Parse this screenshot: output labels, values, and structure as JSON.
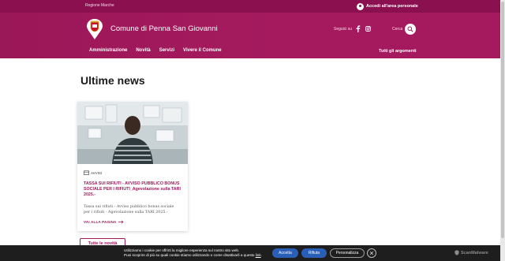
{
  "topbar": {
    "region": "Regione Marche",
    "login": "Accedi all'area personale",
    "login_icon": "user-icon"
  },
  "header": {
    "title": "Comune di Penna San Giovanni",
    "follow_label": "Seguici su",
    "social": [
      "facebook-icon",
      "instagram-icon"
    ],
    "search_label": "Cerca",
    "search_icon": "search-icon"
  },
  "nav": {
    "items": [
      "Amministrazione",
      "Novità",
      "Servizi",
      "Vivere il Comune"
    ],
    "all_topics": "Tutti gli argomenti"
  },
  "main": {
    "heading": "Ultime news",
    "card": {
      "category": "AVVISI",
      "title": "TASSA SUI RIFIUTI - AVVISO PUBBLICO BONUS SOCIALE PER I RIFIUTI_Agevolazione sulla TARI 2025.-",
      "description": "Tassa sui rifiuti - Avviso pubblico bonus sociale per i rifiuti - Agevolazione sulla TARI 2025.-",
      "read_more": "VAI ALLA PAGINA"
    },
    "all_news_button": "Tutte le novità"
  },
  "cookie": {
    "line1": "Utilizziamo i cookie per offrirti la migliore esperienza sul nostro sito web.",
    "line2_prefix": "Puoi scoprire di più su quali cookie stiamo utilizzando o come disattivarli a questo ",
    "line2_link": "link",
    "accept": "Accetta",
    "reject": "Rifiuta",
    "customize": "Personalizza",
    "brand": "ScanMalware"
  },
  "colors": {
    "brand": "#a5195e",
    "topbar": "#8a1050",
    "cookie_bg": "#1e1e1e",
    "button_blue": "#2a5fb8"
  }
}
